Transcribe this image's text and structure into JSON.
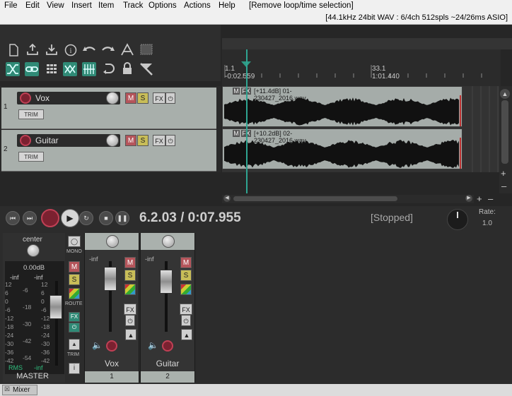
{
  "menu": [
    "File",
    "Edit",
    "View",
    "Insert",
    "Item",
    "Track",
    "Options",
    "Actions",
    "Help"
  ],
  "menu_status": "[Remove loop/time selection]",
  "audio_status": "[44.1kHz 24bit WAV : 6/4ch 512spls ~24/26ms ASIO]",
  "toolbar": {
    "row1_icons": [
      "new-project-icon",
      "save-upload-icon",
      "save-download-icon",
      "info-icon",
      "undo-icon",
      "redo-icon",
      "metronome-icon",
      "grid-icon"
    ],
    "row2_icons": [
      "ripple-editing-icon",
      "link-icon",
      "grid-snap-icon",
      "auto-crossfade-icon",
      "lock-grid-icon",
      "loop-icon",
      "lock-icon",
      "envelope-icon"
    ]
  },
  "ruler": {
    "m1": "1.1",
    "t1": "-0:02.559",
    "m2": "33.1",
    "t2": "1:01.440"
  },
  "tracks": [
    {
      "num": "1",
      "name": "Vox",
      "mute": "M",
      "solo": "S",
      "fx": "FX",
      "trim": "TRIM",
      "item": {
        "m": "M",
        "fx": "FX",
        "label": "[+11.4dB] 01-230427_2016.wav"
      }
    },
    {
      "num": "2",
      "name": "Guitar",
      "mute": "M",
      "solo": "S",
      "fx": "FX",
      "trim": "TRIM",
      "item": {
        "m": "M",
        "fx": "FX",
        "label": "[+10.2dB] 02-230427_2016.wav"
      }
    }
  ],
  "transport": {
    "position": "6.2.03 / 0:07.955",
    "state": "[Stopped]",
    "rate_label": "Rate:",
    "rate_value": "1.0"
  },
  "master": {
    "pan": "center",
    "volume": "0.00dB",
    "peak_l": "-inf",
    "peak_r": "-inf",
    "scale_left": [
      "12",
      "6",
      "0",
      "-6",
      "-12",
      "-18",
      "-24",
      "-30",
      "-36",
      "-42"
    ],
    "scale_mid": [
      "-6",
      "-18",
      "-30",
      "-42",
      "-54"
    ],
    "scale_right": [
      "12",
      "6",
      "0",
      "-6",
      "-12",
      "-18",
      "-24",
      "-30",
      "-36",
      "-42"
    ],
    "rms_label": "RMS",
    "rms_value": "-inf",
    "name": "MASTER",
    "buttons": {
      "mono": "MONO",
      "mute": "M",
      "solo": "S",
      "route": "ROUTE",
      "fx": "FX",
      "trim": "TRIM",
      "info": "i"
    }
  },
  "strips": [
    {
      "peak": "-inf",
      "mute": "M",
      "solo": "S",
      "fx": "FX",
      "name": "Vox",
      "num": "1"
    },
    {
      "peak": "-inf",
      "mute": "M",
      "solo": "S",
      "fx": "FX",
      "name": "Guitar",
      "num": "2"
    }
  ],
  "mixer_tab": "Mixer",
  "colors": {
    "teal": "#2f8a76",
    "mute": "#b5555b",
    "solo": "#c8bd58",
    "track_bg": "#a8afab"
  }
}
